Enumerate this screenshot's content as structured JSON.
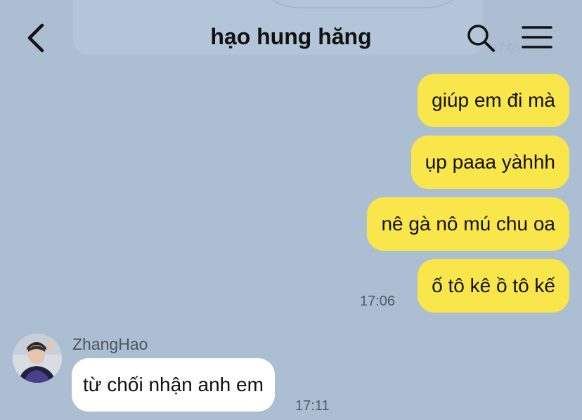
{
  "header": {
    "title": "hạo hung hăng",
    "back_icon": "chevron-left-icon",
    "search_icon": "search-icon",
    "menu_icon": "hamburger-menu-icon"
  },
  "background_peek": {
    "time": "17:05"
  },
  "messages": [
    {
      "direction": "out",
      "text": "giúp em đi mà"
    },
    {
      "direction": "out",
      "text": "ụp paaa yàhhh"
    },
    {
      "direction": "out",
      "text": "nê gà nô mú chu oa"
    },
    {
      "direction": "out",
      "text": "ố tô kê ồ tô kế",
      "time": "17:06"
    },
    {
      "direction": "in",
      "sender": "ZhangHao",
      "text": "từ chối nhận anh em",
      "time": "17:11"
    }
  ],
  "colors": {
    "background": "#acbfd2",
    "outgoing_bubble": "#f9e64b",
    "incoming_bubble": "#ffffff"
  }
}
